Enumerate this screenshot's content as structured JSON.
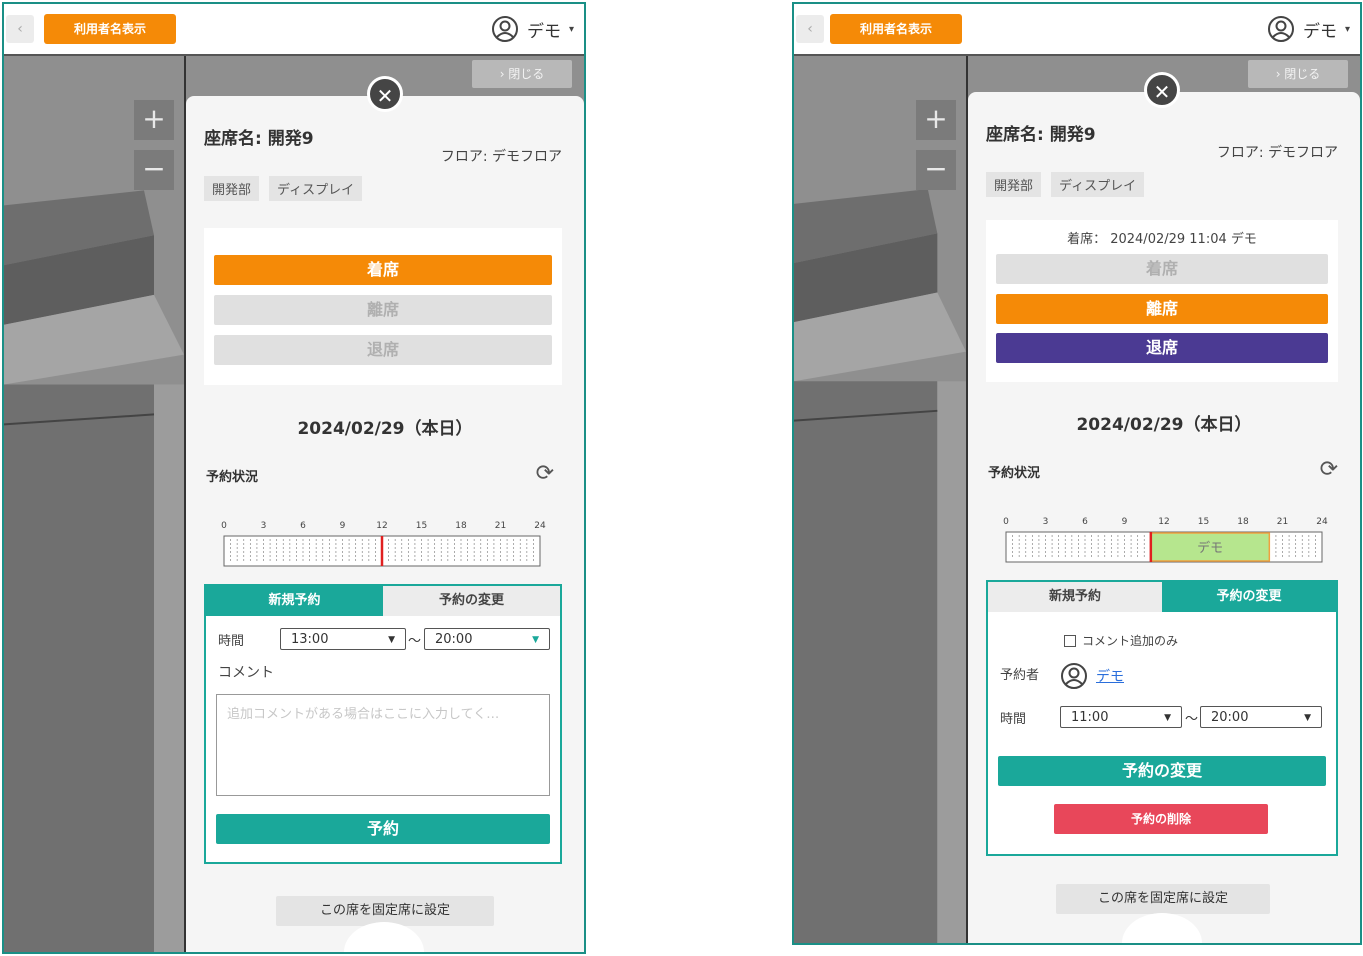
{
  "colors": {
    "accent_orange": "#f58a07",
    "teal": "#1aa89a",
    "purple": "#4b3a93",
    "red": "#e8475a",
    "booking_green": "#b6e68e"
  },
  "screens": [
    {
      "topbar": {
        "back_icon": "‹",
        "show_names_button": "利用者名表示",
        "user_name": "デモ",
        "caret": "▾"
      },
      "map": {
        "zoom_in": "+",
        "zoom_out": "−",
        "close_panel": "› 閉じる",
        "close_icon": "✕"
      },
      "seat": {
        "title": "座席名: 開発9",
        "floor": "フロア: デモフロア",
        "tags": [
          "開発部",
          "ディスプレイ"
        ]
      },
      "status": {
        "occupied_text": "",
        "sit_button": "着席",
        "away_button": "離席",
        "leave_button": "退席"
      },
      "date": "2024/02/29（本日）",
      "reservation": {
        "label": "予約状況",
        "refresh_icon": "⟳",
        "hours": [
          "0",
          "3",
          "6",
          "9",
          "12",
          "15",
          "18",
          "21",
          "24"
        ],
        "current_hour": 12.0,
        "bookings": []
      },
      "tabs": {
        "new": "新規予約",
        "change": "予約の変更",
        "active": "new"
      },
      "form": {
        "time_label": "時間",
        "start": "13:00",
        "end": "20:00",
        "tilde": "～",
        "comment_label": "コメント",
        "comment_placeholder": "追加コメントがある場合はここに入力してく…",
        "submit": "予約"
      },
      "fixed_seat_button": "この席を固定席に設定"
    },
    {
      "topbar": {
        "back_icon": "‹",
        "show_names_button": "利用者名表示",
        "user_name": "デモ",
        "caret": "▾"
      },
      "map": {
        "zoom_in": "+",
        "zoom_out": "−",
        "close_panel": "› 閉じる",
        "close_icon": "✕"
      },
      "seat": {
        "title": "座席名: 開発9",
        "floor": "フロア: デモフロア",
        "tags": [
          "開発部",
          "ディスプレイ"
        ]
      },
      "status": {
        "occupied_text": "着席： 2024/02/29 11:04 デモ",
        "sit_button": "着席",
        "away_button": "離席",
        "leave_button": "退席"
      },
      "date": "2024/02/29（本日）",
      "reservation": {
        "label": "予約状況",
        "refresh_icon": "⟳",
        "hours": [
          "0",
          "3",
          "6",
          "9",
          "12",
          "15",
          "18",
          "21",
          "24"
        ],
        "current_hour": 11.0,
        "bookings": [
          {
            "start": 11.0,
            "end": 20.0,
            "name": "デモ"
          }
        ]
      },
      "tabs": {
        "new": "新規予約",
        "change": "予約の変更",
        "active": "change"
      },
      "form": {
        "comment_only": "コメント追加のみ",
        "reserver_label": "予約者",
        "reserver_name": "デモ",
        "time_label": "時間",
        "start": "11:00",
        "end": "20:00",
        "tilde": "～",
        "submit": "予約の変更",
        "delete": "予約の削除"
      },
      "fixed_seat_button": "この席を固定席に設定"
    }
  ]
}
